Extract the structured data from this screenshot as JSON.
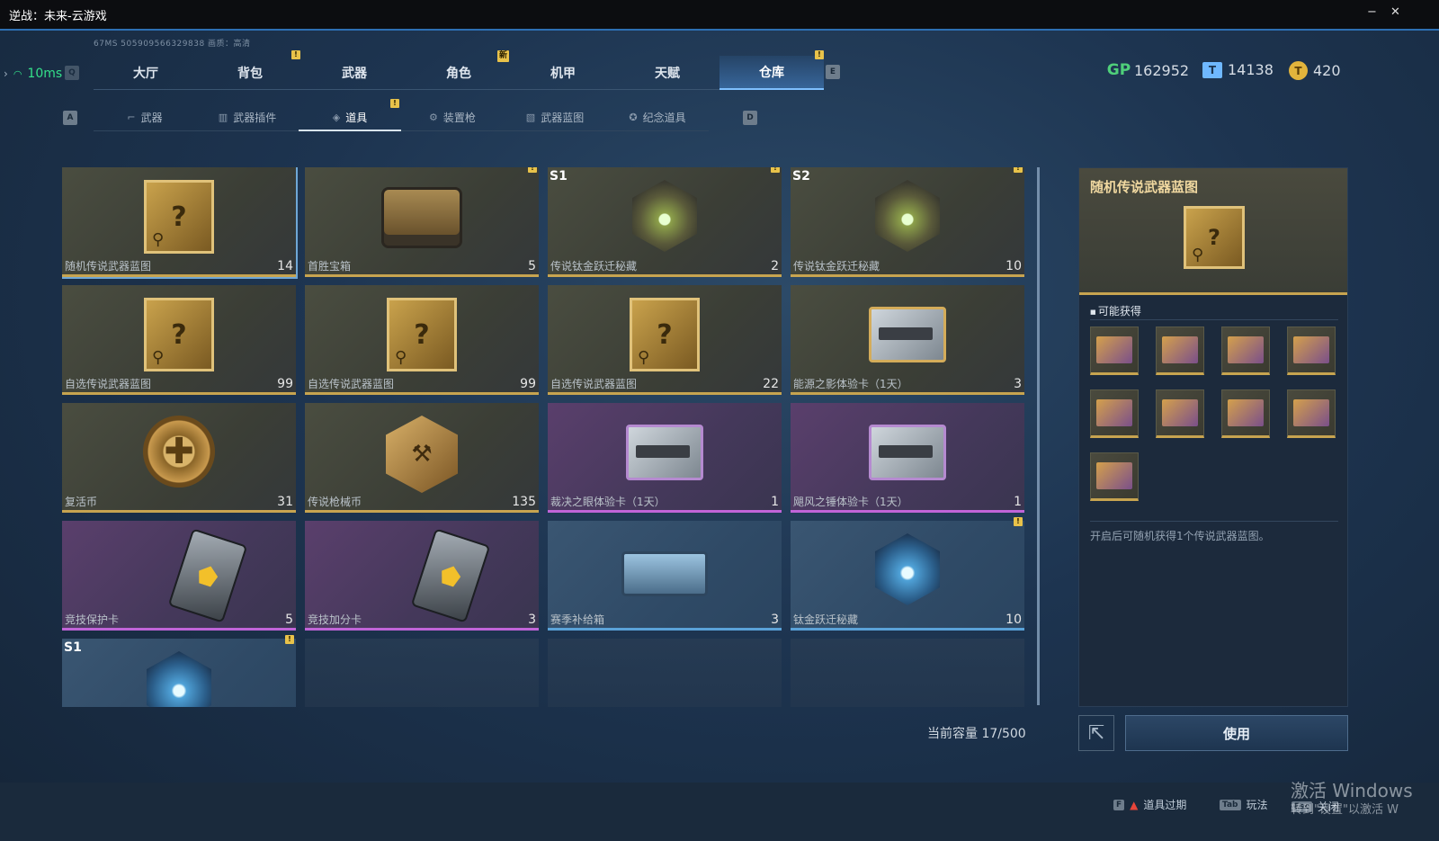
{
  "window": {
    "title": "逆战：未来-云游戏",
    "min": "−",
    "close": "✕"
  },
  "info": {
    "line": "67MS  505909566329838      画质：高清"
  },
  "ping": {
    "value": "10ms"
  },
  "keys": {
    "q": "Q",
    "e": "E",
    "a": "A",
    "d": "D"
  },
  "main_tabs": [
    {
      "label": "大厅",
      "badge": ""
    },
    {
      "label": "背包",
      "badge": "!"
    },
    {
      "label": "武器",
      "badge": ""
    },
    {
      "label": "角色",
      "badge": "新"
    },
    {
      "label": "机甲",
      "badge": ""
    },
    {
      "label": "天赋",
      "badge": ""
    },
    {
      "label": "仓库",
      "badge": "!"
    }
  ],
  "currency": [
    {
      "icon": "gp-icon",
      "glyph": "GP",
      "value": "162952",
      "color": "#4fcf7a"
    },
    {
      "icon": "ticket-icon",
      "glyph": "T",
      "value": "14138",
      "color": "#6fb8ff"
    },
    {
      "icon": "gold-coin-icon",
      "glyph": "T",
      "value": "420",
      "color": "#e2b43c"
    }
  ],
  "sub_tabs": [
    {
      "label": "武器",
      "icon": "weapon-icon",
      "glyph": "⌐"
    },
    {
      "label": "武器插件",
      "icon": "plugin-icon",
      "glyph": "▥"
    },
    {
      "label": "道具",
      "icon": "item-icon",
      "glyph": "◈"
    },
    {
      "label": "装置枪",
      "icon": "device-gun-icon",
      "glyph": "⚙"
    },
    {
      "label": "武器蓝图",
      "icon": "blueprint-icon",
      "glyph": "▧"
    },
    {
      "label": "纪念道具",
      "icon": "souvenir-icon",
      "glyph": "✪"
    }
  ],
  "items": [
    {
      "name": "随机传说武器蓝图",
      "count": "14",
      "season": "",
      "badge": "",
      "rarity": "gold",
      "art": "blueprint",
      "selected": true
    },
    {
      "name": "首胜宝箱",
      "count": "5",
      "season": "",
      "badge": "!",
      "rarity": "gold",
      "art": "chest"
    },
    {
      "name": "传说钛金跃迁秘藏",
      "count": "2",
      "season": "S1",
      "badge": "!",
      "rarity": "gold",
      "art": "crystal"
    },
    {
      "name": "传说钛金跃迁秘藏",
      "count": "10",
      "season": "S2",
      "badge": "!",
      "rarity": "gold",
      "art": "crystal"
    },
    {
      "name": "自选传说武器蓝图",
      "count": "99",
      "season": "",
      "badge": "",
      "rarity": "gold",
      "art": "blueprint"
    },
    {
      "name": "自选传说武器蓝图",
      "count": "99",
      "season": "",
      "badge": "",
      "rarity": "gold",
      "art": "blueprint"
    },
    {
      "name": "自选传说武器蓝图",
      "count": "22",
      "season": "",
      "badge": "",
      "rarity": "gold",
      "art": "blueprint"
    },
    {
      "name": "能源之影体验卡（1天）",
      "count": "3",
      "season": "",
      "badge": "",
      "rarity": "gold",
      "art": "gun-gold"
    },
    {
      "name": "复活币",
      "count": "31",
      "season": "",
      "badge": "",
      "rarity": "gold",
      "art": "coin"
    },
    {
      "name": "传说枪械币",
      "count": "135",
      "season": "",
      "badge": "",
      "rarity": "gold",
      "art": "hexcoin"
    },
    {
      "name": "裁决之眼体验卡（1天）",
      "count": "1",
      "season": "",
      "badge": "",
      "rarity": "purple",
      "art": "gun"
    },
    {
      "name": "飓风之锤体验卡（1天）",
      "count": "1",
      "season": "",
      "badge": "",
      "rarity": "purple",
      "art": "gun"
    },
    {
      "name": "竞技保护卡",
      "count": "5",
      "season": "",
      "badge": "",
      "rarity": "purple",
      "art": "card"
    },
    {
      "name": "竞技加分卡",
      "count": "3",
      "season": "",
      "badge": "",
      "rarity": "purple",
      "art": "card"
    },
    {
      "name": "赛季补给箱",
      "count": "3",
      "season": "",
      "badge": "",
      "rarity": "blue",
      "art": "supply"
    },
    {
      "name": "钛金跃迁秘藏",
      "count": "10",
      "season": "",
      "badge": "!",
      "rarity": "blue",
      "art": "crystal-blue"
    },
    {
      "name": "",
      "count": "",
      "season": "S1",
      "badge": "!",
      "rarity": "blue",
      "art": "crystal-blue"
    },
    {
      "name": "",
      "count": "",
      "season": "",
      "badge": "",
      "rarity": "empty",
      "art": ""
    },
    {
      "name": "",
      "count": "",
      "season": "",
      "badge": "",
      "rarity": "empty",
      "art": ""
    },
    {
      "name": "",
      "count": "",
      "season": "",
      "badge": "",
      "rarity": "empty",
      "art": ""
    }
  ],
  "capacity": "当前容量 17/500",
  "detail": {
    "title": "随机传说武器蓝图",
    "possible_label": "可能获得",
    "reward_count": 9,
    "description": "开启后可随机获得1个传说武器蓝图。",
    "use_label": "使用"
  },
  "bottom": {
    "expire_key": "F",
    "expire_label": "道具过期",
    "play_key": "Tab",
    "play_label": "玩法",
    "close_key": "Esc",
    "close_label": "关闭"
  },
  "watermark": {
    "line1": "激活 Windows",
    "line2": "转到\"设置\"以激活 W"
  }
}
